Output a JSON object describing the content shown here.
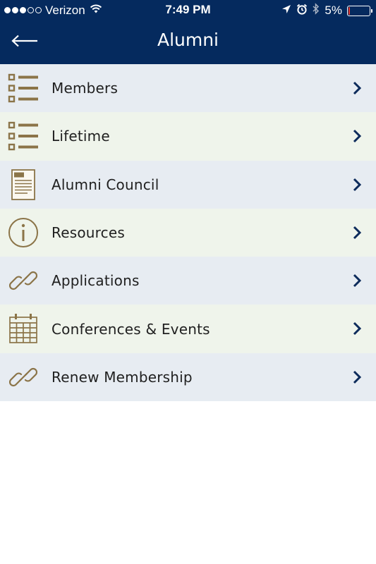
{
  "status_bar": {
    "carrier": "Verizon",
    "time": "7:49 PM",
    "battery_percent": "5%",
    "battery_level": 0.05,
    "signal_dots_filled": 3,
    "signal_dots_total": 5,
    "icons": [
      "wifi-icon",
      "location-arrow-icon",
      "alarm-icon",
      "bluetooth-icon",
      "battery-icon"
    ]
  },
  "nav": {
    "title": "Alumni",
    "back_icon": "back-arrow-icon"
  },
  "colors": {
    "header_bg": "#052a5e",
    "icon_gold": "#8b7448",
    "chevron": "#0d2b5b",
    "row_blue": "#e7ecf2",
    "row_green": "#eff4eb",
    "battery_low": "#e8392c"
  },
  "menu": {
    "items": [
      {
        "label": "Members",
        "icon": "list-icon"
      },
      {
        "label": "Lifetime",
        "icon": "list-icon"
      },
      {
        "label": "Alumni Council",
        "icon": "pdf-document-icon"
      },
      {
        "label": "Resources",
        "icon": "info-icon"
      },
      {
        "label": "Applications",
        "icon": "link-icon"
      },
      {
        "label": "Conferences & Events",
        "icon": "calendar-icon"
      },
      {
        "label": "Renew Membership",
        "icon": "link-icon"
      }
    ]
  }
}
